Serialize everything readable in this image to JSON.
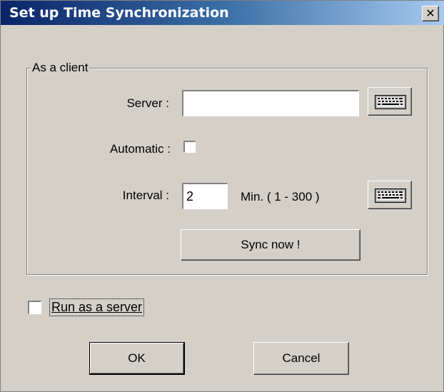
{
  "window": {
    "title": "Set up Time Synchronization",
    "close_glyph": "✕",
    "close_icon": "close-icon"
  },
  "client_group": {
    "label": "As a client",
    "server_label": "Server :",
    "server_value": "",
    "automatic_label": "Automatic :",
    "automatic_checked": false,
    "interval_label": "Interval :",
    "interval_value": "2",
    "interval_unit": "Min. ( 1 - 300 )",
    "sync_button": "Sync now !",
    "keyboard_icon": "keyboard-icon"
  },
  "server_option": {
    "label": "Run as a server",
    "checked": false
  },
  "buttons": {
    "ok": "OK",
    "cancel": "Cancel"
  },
  "colors": {
    "face": "#d4d0c8",
    "title_start": "#0a246a",
    "title_end": "#a6caf0"
  }
}
